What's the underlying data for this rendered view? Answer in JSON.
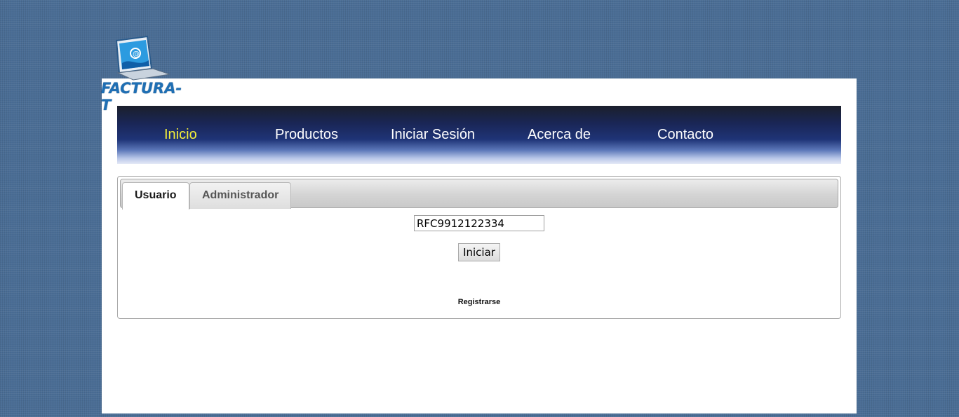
{
  "logo": {
    "text": "FACTURA-T",
    "icon": "laptop-at-icon"
  },
  "nav": {
    "items": [
      {
        "label": "Inicio",
        "active": true
      },
      {
        "label": "Productos",
        "active": false
      },
      {
        "label": "Iniciar Sesión",
        "active": false
      },
      {
        "label": "Acerca de",
        "active": false
      },
      {
        "label": "Contacto",
        "active": false
      }
    ]
  },
  "tabs": [
    {
      "label": "Usuario",
      "active": true
    },
    {
      "label": "Administrador",
      "active": false
    }
  ],
  "form": {
    "rfc_value": "RFC9912122334",
    "submit_label": "Iniciar",
    "register_label": "Registrarse"
  },
  "colors": {
    "background": "#4a6d95",
    "nav_active": "#f2ee3a",
    "logo_text": "#1f6fb4"
  }
}
